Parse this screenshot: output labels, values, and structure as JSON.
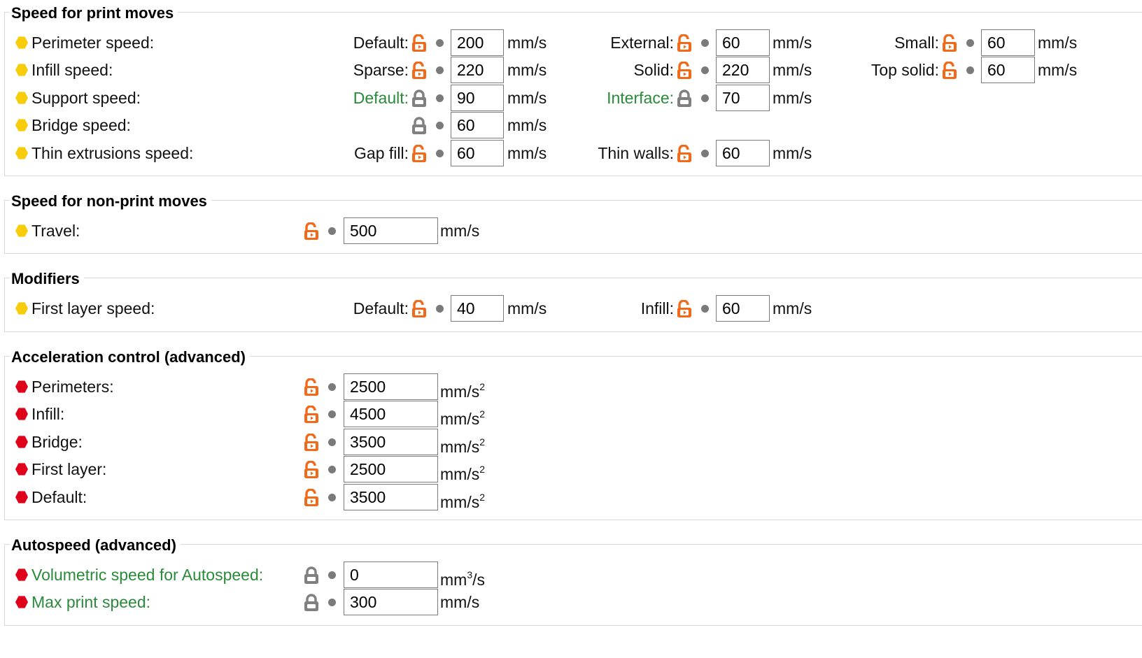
{
  "sections": {
    "print_moves": {
      "title": "Speed for print moves",
      "rows": {
        "perimeter": {
          "label": "Perimeter speed:",
          "default_label": "Default:",
          "default_value": "200",
          "external_label": "External:",
          "external_value": "60",
          "small_label": "Small:",
          "small_value": "60"
        },
        "infill": {
          "label": "Infill speed:",
          "sparse_label": "Sparse:",
          "sparse_value": "220",
          "solid_label": "Solid:",
          "solid_value": "220",
          "top_solid_label": "Top solid:",
          "top_solid_value": "60"
        },
        "support": {
          "label": "Support speed:",
          "default_label": "Default:",
          "default_value": "90",
          "interface_label": "Interface:",
          "interface_value": "70"
        },
        "bridge": {
          "label": "Bridge speed:",
          "value": "60"
        },
        "thin": {
          "label": "Thin extrusions speed:",
          "gap_fill_label": "Gap fill:",
          "gap_fill_value": "60",
          "thin_walls_label": "Thin walls:",
          "thin_walls_value": "60"
        }
      }
    },
    "non_print_moves": {
      "title": "Speed for non-print moves",
      "travel": {
        "label": "Travel:",
        "value": "500"
      }
    },
    "modifiers": {
      "title": "Modifiers",
      "first_layer": {
        "label": "First layer speed:",
        "default_label": "Default:",
        "default_value": "40",
        "infill_label": "Infill:",
        "infill_value": "60"
      }
    },
    "acceleration": {
      "title": "Acceleration control (advanced)",
      "perimeters": {
        "label": "Perimeters:",
        "value": "2500"
      },
      "infill": {
        "label": "Infill:",
        "value": "4500"
      },
      "bridge": {
        "label": "Bridge:",
        "value": "3500"
      },
      "first_layer": {
        "label": "First layer:",
        "value": "2500"
      },
      "default": {
        "label": "Default:",
        "value": "3500"
      }
    },
    "autospeed": {
      "title": "Autospeed (advanced)",
      "volumetric": {
        "label": "Volumetric speed for Autospeed:",
        "value": "0"
      },
      "max_print": {
        "label": "Max print speed:",
        "value": "300"
      }
    }
  },
  "units": {
    "speed": "mm/s",
    "accel_base": "mm/s",
    "accel_exp": "2",
    "vol_base": "mm",
    "vol_exp": "3",
    "vol_tail": "/s"
  },
  "colors": {
    "simple_mode": "#f7cc0a",
    "expert_mode": "#e0001b",
    "unlocked_lock": "#f06a1a",
    "locked_lock": "#808080",
    "system_value_label": "#2a8a3a"
  },
  "icons": {
    "mode_simple": "yellow-hexagon",
    "mode_expert": "red-hexagon",
    "unlocked": "unlocked-padlock",
    "locked": "locked-padlock",
    "reset": "bullet-dot"
  }
}
